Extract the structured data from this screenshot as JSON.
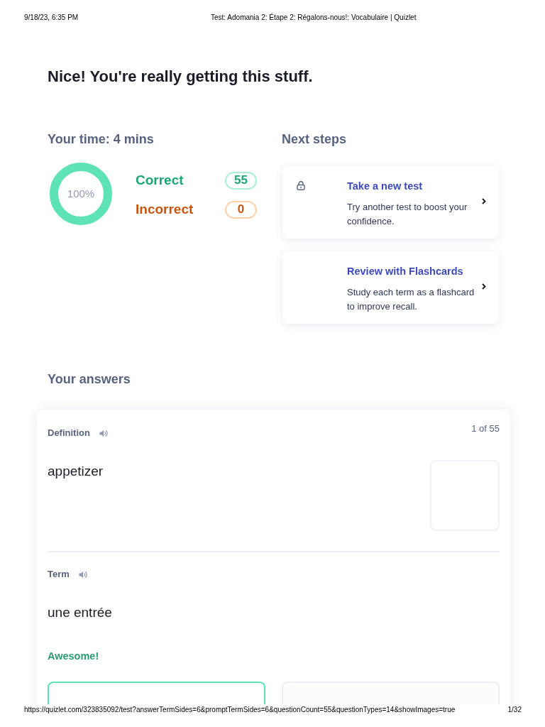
{
  "print_header": {
    "date": "9/18/23, 6:35 PM",
    "title": "Test: Adomania 2: Étape 2: Régalons-nous!: Vocabulaire | Quizlet"
  },
  "heading": "Nice! You're really getting this stuff.",
  "results": {
    "title": "Your time: 4 mins",
    "progress": {
      "label": "100%",
      "level": 1
    },
    "scores": [
      {
        "kind": "correct",
        "label": "Correct",
        "count": "55"
      },
      {
        "kind": "incorrect",
        "label": "Incorrect",
        "count": "0"
      }
    ]
  },
  "next_steps": {
    "title": "Next steps",
    "cards": [
      {
        "title": "Take a new test",
        "description": "Try another test to boost your confidence.",
        "locked": true
      },
      {
        "title": "Review with Flashcards",
        "description": "Study each term as a flashcard to improve recall.",
        "locked": false
      }
    ]
  },
  "answers": {
    "title": "Your answers",
    "items": [
      {
        "counter": "1 of 55",
        "sections": [
          {
            "label": "Definition",
            "text": "appetizer",
            "image_slot": true
          },
          {
            "label": "Term",
            "text": "une entrée",
            "image_slot": false
          }
        ],
        "feedback": {
          "kind": "correct",
          "text": "Awesome!"
        },
        "options": [
          {
            "correct": true
          },
          {
            "correct": false
          }
        ]
      }
    ]
  },
  "print_footer": {
    "url": "https://quizlet.com/323835092/test?answerTermSides=6&promptTermSides=6&questionCount=55&questionTypes=14&showImages=true",
    "page": "1/32"
  }
}
